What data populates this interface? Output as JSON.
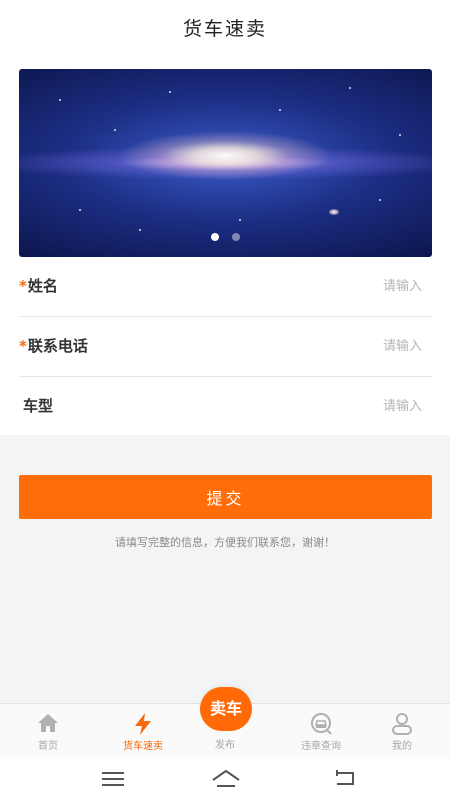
{
  "header": {
    "title": "货车速卖"
  },
  "banner": {
    "page_count": 2,
    "active_index": 0
  },
  "form": {
    "name": {
      "label": "姓名",
      "required": true,
      "placeholder": "请输入",
      "value": ""
    },
    "phone": {
      "label": "联系电话",
      "required": true,
      "placeholder": "请输入",
      "value": ""
    },
    "model": {
      "label": "车型",
      "required": false,
      "placeholder": "请输入",
      "value": ""
    },
    "required_mark": "*"
  },
  "submit": {
    "label": "提交"
  },
  "hint": "请填写完整的信息，方便我们联系您，谢谢！",
  "tabbar": {
    "items": [
      {
        "label": "首页",
        "icon": "home-icon",
        "active": false
      },
      {
        "label": "货车速卖",
        "icon": "lightning-icon",
        "active": true
      },
      {
        "label": "发布",
        "icon": "sell-icon",
        "active": false,
        "badge": "卖车"
      },
      {
        "label": "违章查询",
        "icon": "car-search-icon",
        "active": false
      },
      {
        "label": "我的",
        "icon": "user-icon",
        "active": false
      }
    ]
  },
  "colors": {
    "accent": "#fe6d08",
    "inactive": "#a7a7a7"
  },
  "system_nav": [
    "menu-icon",
    "home-outline-icon",
    "back-icon"
  ]
}
